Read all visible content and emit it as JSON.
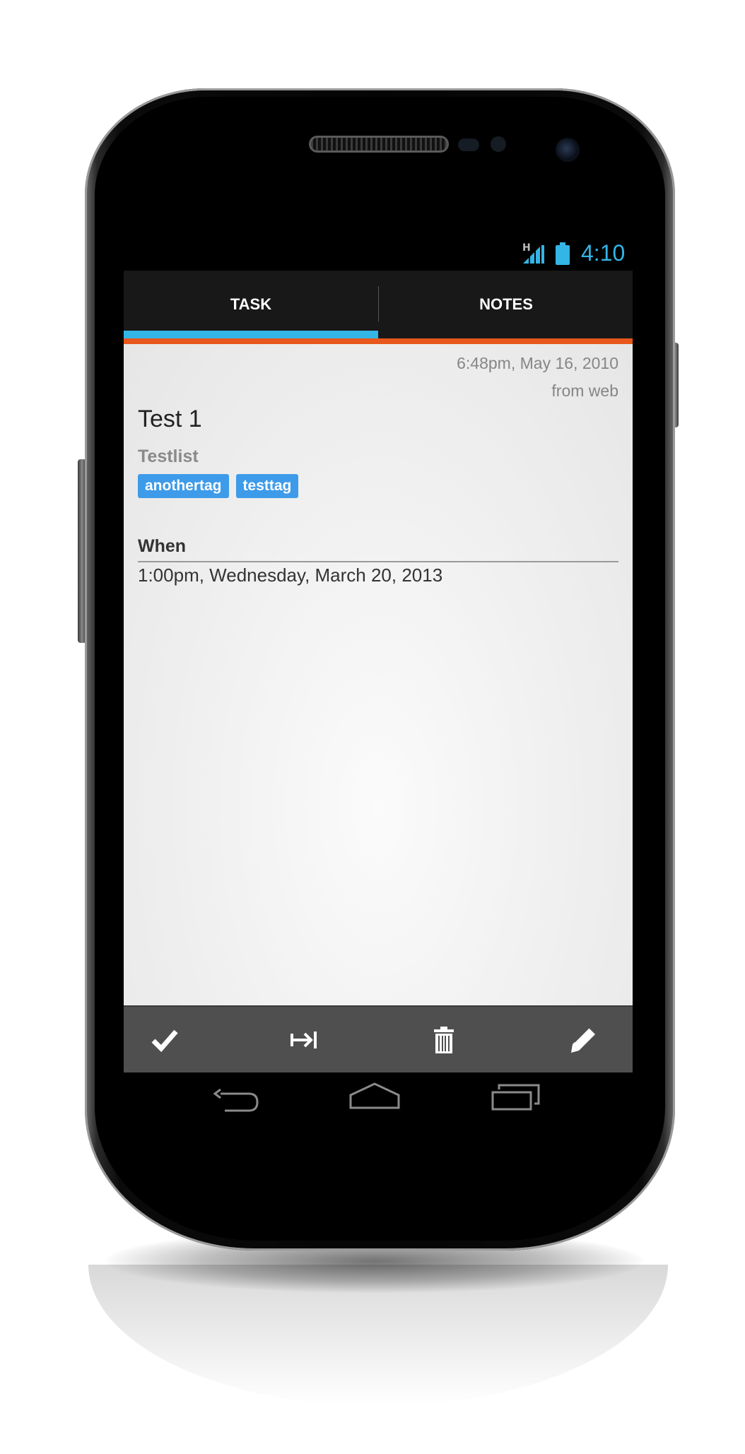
{
  "status_bar": {
    "network_type": "H",
    "clock": "4:10",
    "accent_color": "#33b5e5",
    "icons": [
      "signal-icon",
      "battery-icon"
    ]
  },
  "tabs": [
    {
      "label": "TASK",
      "selected": true
    },
    {
      "label": "NOTES",
      "selected": false
    }
  ],
  "task": {
    "created": "6:48pm, May 16, 2010",
    "source": "from web",
    "title": "Test 1",
    "list": "Testlist",
    "tags": [
      "anothertag",
      "testtag"
    ],
    "when_label": "When",
    "when_value": "1:00pm, Wednesday, March 20, 2013"
  },
  "action_bar": {
    "icons": [
      "checkmark-icon",
      "postpone-icon",
      "trash-icon",
      "pencil-icon"
    ]
  },
  "nav_bar": {
    "icons": [
      "back-icon",
      "home-icon",
      "recent-apps-icon"
    ]
  },
  "colors": {
    "tab_indicator": "#33b5e5",
    "accent_strip": "#e8571b",
    "tag_background": "#3d9be9"
  }
}
